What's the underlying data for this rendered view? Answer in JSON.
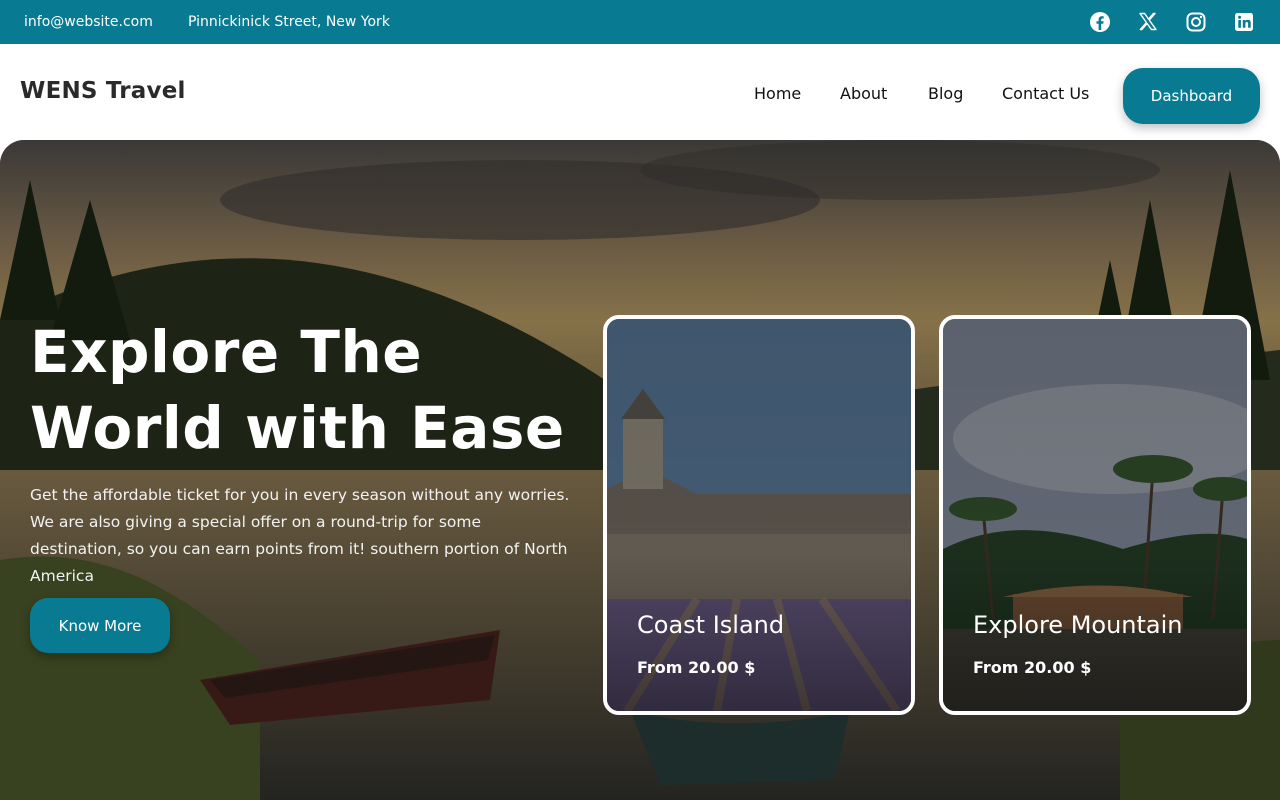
{
  "topbar": {
    "email": "info@website.com",
    "address": "Pinnickinick Street, New York",
    "social_icons": [
      "facebook-icon",
      "x-twitter-icon",
      "instagram-icon",
      "linkedin-icon"
    ]
  },
  "navbar": {
    "brand": "WENS Travel",
    "links": [
      "Home",
      "About",
      "Blog",
      "Contact Us"
    ],
    "dashboard_label": "Dashboard"
  },
  "hero": {
    "title": "Explore The World with Ease",
    "description": "Get the affordable ticket for you in every season without any worries. We are also giving a special offer on a round-trip for some destination, so you can earn points from it! southern portion of North America",
    "cta_label": "Know More"
  },
  "cards": [
    {
      "title": "Coast Island",
      "price": "From 20.00 $"
    },
    {
      "title": "Explore Mountain",
      "price": "From 20.00 $"
    }
  ],
  "colors": {
    "accent": "#087a92",
    "white": "#ffffff"
  }
}
